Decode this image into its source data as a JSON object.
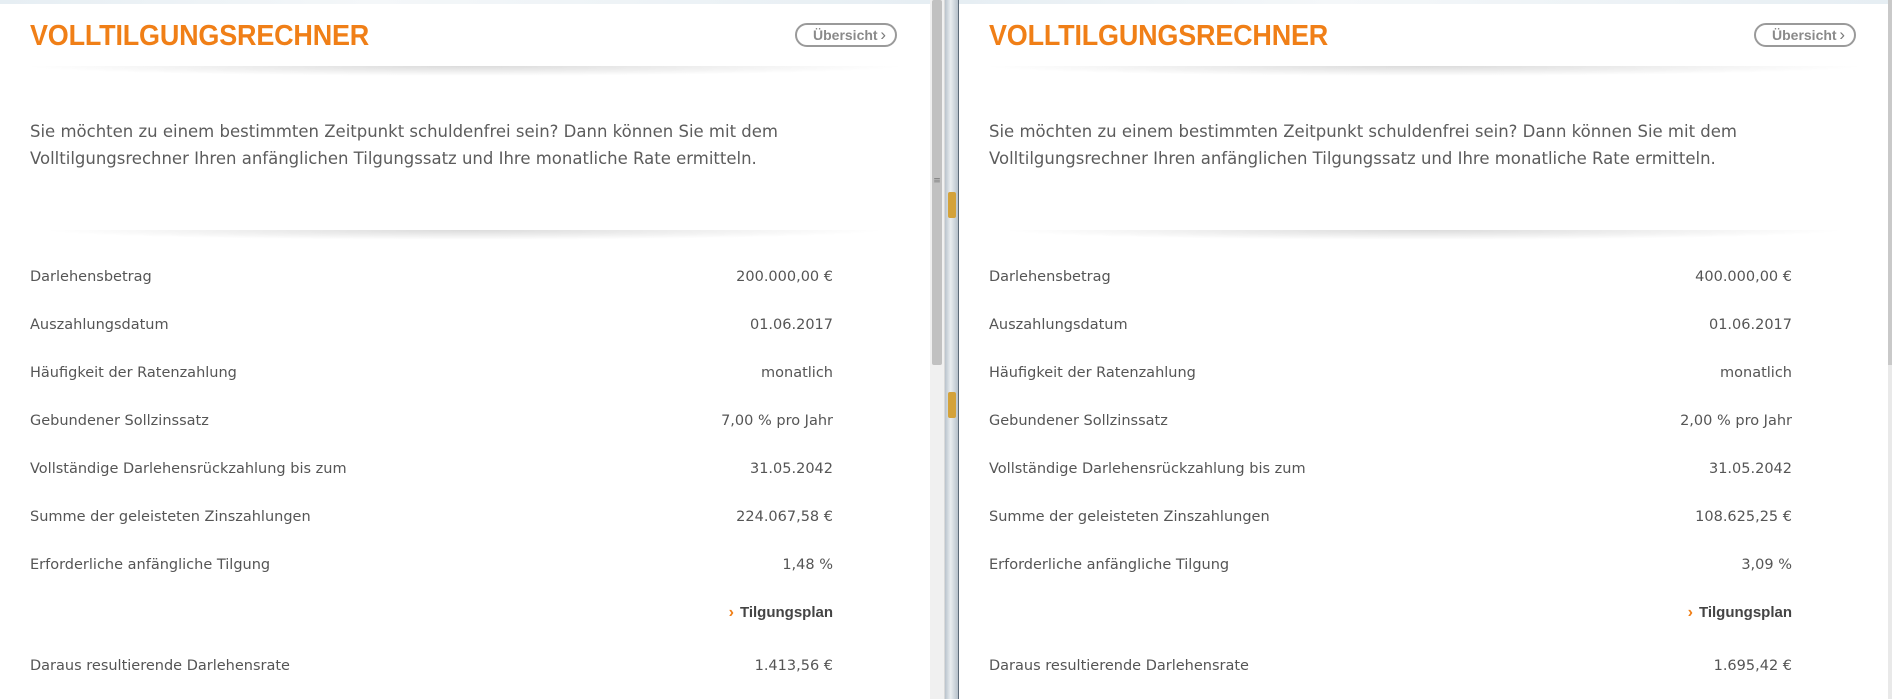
{
  "panes": [
    {
      "title": "VOLLTILGUNGSRECHNER",
      "overview_button": "Übersicht",
      "intro": "Sie möchten zu einem bestimmten Zeitpunkt schuldenfrei sein? Dann können Sie mit dem Volltilgungsrechner Ihren anfänglichen Tilgungssatz und Ihre monatliche Rate ermitteln.",
      "rows": [
        {
          "label": "Darlehensbetrag",
          "value": "200.000,00 €"
        },
        {
          "label": "Auszahlungsdatum",
          "value": "01.06.2017"
        },
        {
          "label": "Häufigkeit der Ratenzahlung",
          "value": "monatlich"
        },
        {
          "label": "Gebundener Sollzinssatz",
          "value": "7,00 % pro Jahr"
        },
        {
          "label": "Vollständige Darlehensrückzahlung bis zum",
          "value": "31.05.2042"
        },
        {
          "label": "Summe der geleisteten Zinszahlungen",
          "value": "224.067,58 €"
        },
        {
          "label": "Erforderliche anfängliche Tilgung",
          "value": "1,48 %"
        }
      ],
      "plan_link": "Tilgungsplan",
      "result": {
        "label": "Daraus resultierende Darlehensrate",
        "value": "1.413,56 €"
      }
    },
    {
      "title": "VOLLTILGUNGSRECHNER",
      "overview_button": "Übersicht",
      "intro": "Sie möchten zu einem bestimmten Zeitpunkt schuldenfrei sein? Dann können Sie mit dem Volltilgungsrechner Ihren anfänglichen Tilgungssatz und Ihre monatliche Rate ermitteln.",
      "rows": [
        {
          "label": "Darlehensbetrag",
          "value": "400.000,00 €"
        },
        {
          "label": "Auszahlungsdatum",
          "value": "01.06.2017"
        },
        {
          "label": "Häufigkeit der Ratenzahlung",
          "value": "monatlich"
        },
        {
          "label": "Gebundener Sollzinssatz",
          "value": "2,00 % pro Jahr"
        },
        {
          "label": "Vollständige Darlehensrückzahlung bis zum",
          "value": "31.05.2042"
        },
        {
          "label": "Summe der geleisteten Zinszahlungen",
          "value": "108.625,25 €"
        },
        {
          "label": "Erforderliche anfängliche Tilgung",
          "value": "3,09 %"
        }
      ],
      "plan_link": "Tilgungsplan",
      "result": {
        "label": "Daraus resultierende Darlehensrate",
        "value": "1.695,42 €"
      }
    }
  ],
  "icons": {
    "overview_chevron": "chevron-right-icon",
    "plan_arrow": "chevron-right-icon",
    "splitter_grip": "grip-icon"
  },
  "colors": {
    "accent": "#f07f17",
    "text": "#555555",
    "divider": "#5d6b78"
  }
}
